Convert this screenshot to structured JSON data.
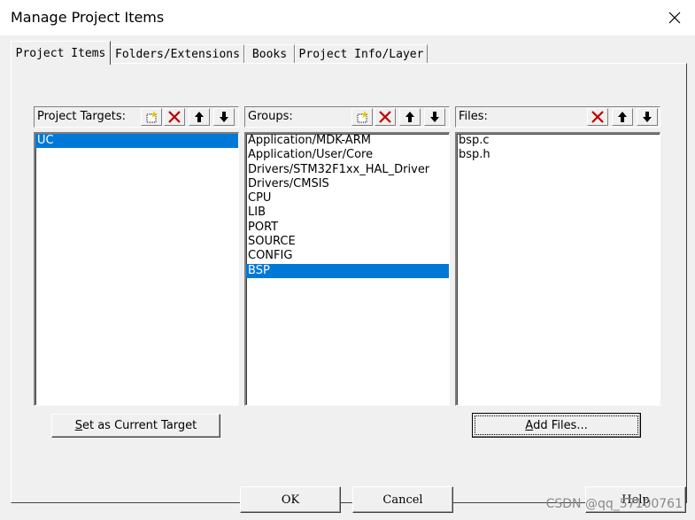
{
  "window": {
    "title": "Manage Project Items"
  },
  "tabs": [
    {
      "label": "Project Items"
    },
    {
      "label": "Folders/Extensions"
    },
    {
      "label": "Books"
    },
    {
      "label": "Project Info/Layer"
    }
  ],
  "targets": {
    "label": "Project Targets:",
    "items": [
      "UC"
    ],
    "selected": "UC"
  },
  "groups": {
    "label": "Groups:",
    "items": [
      "Application/MDK-ARM",
      "Application/User/Core",
      "Drivers/STM32F1xx_HAL_Driver",
      "Drivers/CMSIS",
      "CPU",
      "LIB",
      "PORT",
      "SOURCE",
      "CONFIG",
      "BSP"
    ],
    "selected": "BSP"
  },
  "files": {
    "label": "Files:",
    "items": [
      "bsp.c",
      "bsp.h"
    ]
  },
  "buttons": {
    "set_target_prefix": "S",
    "set_target_rest": "et as Current Target",
    "add_files_prefix": "A",
    "add_files_rest": "dd Files...",
    "ok": "OK",
    "cancel": "Cancel",
    "help": "Help"
  },
  "watermark": "CSDN @qq_57100761",
  "colors": {
    "selection": "#0078d7",
    "delete_icon": "#c00000"
  }
}
